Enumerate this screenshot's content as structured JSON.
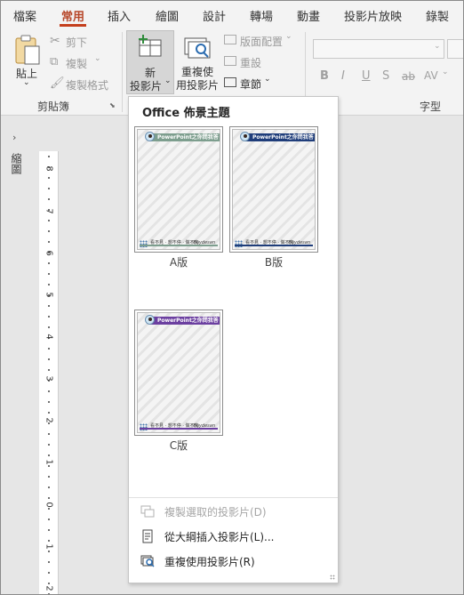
{
  "tabs": [
    "檔案",
    "常用",
    "插入",
    "繪圖",
    "設計",
    "轉場",
    "動畫",
    "投影片放映",
    "錄製"
  ],
  "active_tab": "常用",
  "clipboard": {
    "paste_label": "貼上",
    "cut_label": "剪下",
    "copy_label": "複製",
    "format_painter_label": "複製格式",
    "group_label": "剪貼簿"
  },
  "slides": {
    "new_slide_line1": "新",
    "new_slide_line2": "投影片",
    "reuse_line1": "重複使",
    "reuse_line2": "用投影片",
    "layout_label": "版面配置",
    "reset_label": "重設",
    "section_label": "章節"
  },
  "font": {
    "group_label": "字型",
    "bold": "B",
    "italic": "I",
    "underline": "U",
    "shadow": "S",
    "strikethrough": "ab",
    "spacing": "AV"
  },
  "sidebar": {
    "expand_glyph": "›",
    "label": "縮圖"
  },
  "ruler": {
    "numbers": [
      "8",
      "7",
      "6",
      "5",
      "4",
      "3",
      "2",
      "1",
      "0",
      "1",
      "2"
    ]
  },
  "dropdown": {
    "title": "Office 佈景主題",
    "layouts": [
      {
        "name": "A版",
        "header_text": "PowerPoint之你問我答",
        "footer_text": "看不見 · 想不停 · 做不完",
        "signature": "Boydesan",
        "theme_color": "#7d9e8e"
      },
      {
        "name": "B版",
        "header_text": "PowerPoint之你問我答",
        "footer_text": "看不見 · 想不停 · 做不完",
        "signature": "Boydesan",
        "theme_color": "#1f3d7a"
      },
      {
        "name": "C版",
        "header_text": "PowerPoint之你問我答",
        "footer_text": "看不見 · 想不停 · 做不完",
        "signature": "Boydesan",
        "theme_color": "#6b3fa0"
      }
    ],
    "menu": [
      {
        "label": "複製選取的投影片(D)",
        "enabled": false
      },
      {
        "label": "從大綱插入投影片(L)...",
        "enabled": true
      },
      {
        "label": "重複使用投影片(R)",
        "enabled": true
      }
    ]
  },
  "colors": {
    "accent": "#c43e1c",
    "ribbon_bg": "#f3f3f3",
    "workspace_bg": "#e6e6e6"
  }
}
